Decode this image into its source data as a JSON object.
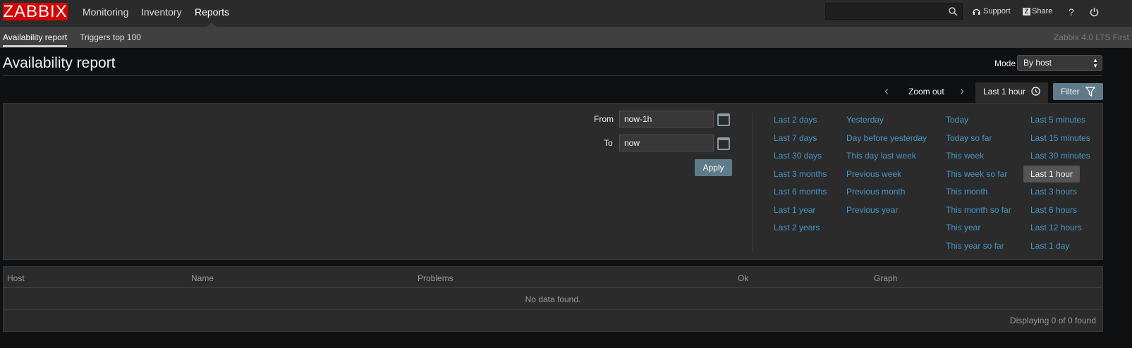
{
  "header": {
    "logo": "ZABBIX",
    "nav": [
      "Monitoring",
      "Inventory",
      "Reports"
    ],
    "search_value": "",
    "support": "Support",
    "share": "Share",
    "help": "?"
  },
  "subnav": {
    "items": [
      "Availability report",
      "Triggers top 100"
    ],
    "version": "Zabbix 4.0 LTS First"
  },
  "page": {
    "title": "Availability report",
    "mode_label": "Mode",
    "mode_value": "By host"
  },
  "timebar": {
    "zoom_out": "Zoom out",
    "current": "Last 1 hour",
    "filter": "Filter"
  },
  "filter": {
    "from_label": "From",
    "from_value": "now-1h",
    "to_label": "To",
    "to_value": "now",
    "apply": "Apply",
    "quick": [
      [
        "Last 2 days",
        "Last 7 days",
        "Last 30 days",
        "Last 3 months",
        "Last 6 months",
        "Last 1 year",
        "Last 2 years"
      ],
      [
        "Yesterday",
        "Day before yesterday",
        "This day last week",
        "Previous week",
        "Previous month",
        "Previous year"
      ],
      [
        "Today",
        "Today so far",
        "This week",
        "This week so far",
        "This month",
        "This month so far",
        "This year",
        "This year so far"
      ],
      [
        "Last 5 minutes",
        "Last 15 minutes",
        "Last 30 minutes",
        "Last 1 hour",
        "Last 3 hours",
        "Last 6 hours",
        "Last 12 hours",
        "Last 1 day"
      ]
    ],
    "selected": "Last 1 hour"
  },
  "table": {
    "columns": [
      "Host",
      "Name",
      "Problems",
      "Ok",
      "Graph"
    ],
    "empty": "No data found.",
    "footer": "Displaying 0 of 0 found"
  }
}
